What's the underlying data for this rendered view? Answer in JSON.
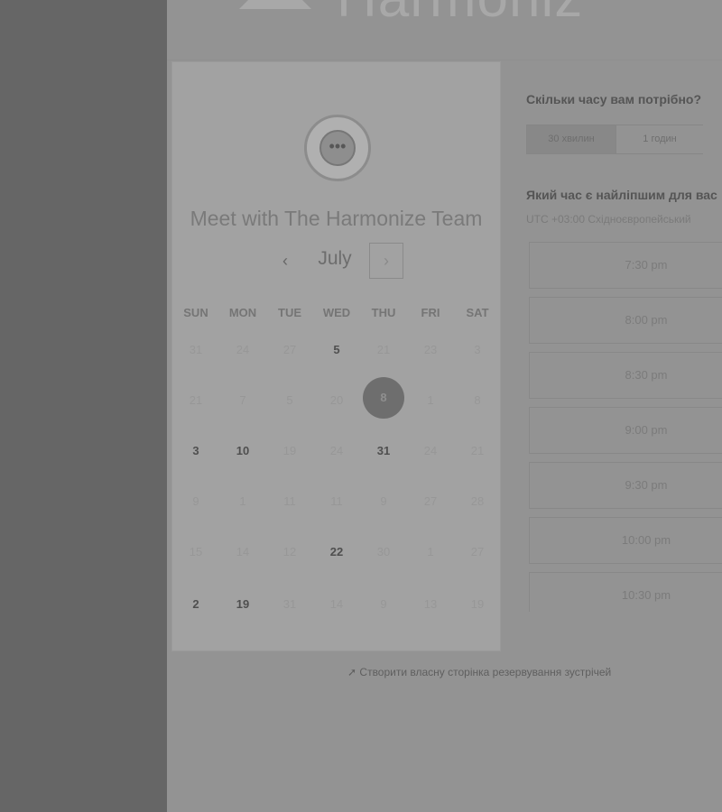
{
  "header": {
    "brand_text": "Harmoniz"
  },
  "card": {
    "title": "Meet with The Harmonize Team",
    "month": "July",
    "prev_icon": "‹",
    "next_icon": "›",
    "weekdays": [
      "SUN",
      "MON",
      "TUE",
      "WED",
      "THU",
      "FRI",
      "SAT"
    ],
    "weeks": [
      [
        "31",
        "24",
        "27",
        "5",
        "21",
        "23",
        "3"
      ],
      [
        "21",
        "7",
        "5",
        "20",
        "8",
        "1",
        "8"
      ],
      [
        "3",
        "10",
        "19",
        "24",
        "31",
        "24",
        "21"
      ],
      [
        "9",
        "1",
        "11",
        "11",
        "9",
        "27",
        "28"
      ],
      [
        "15",
        "14",
        "12",
        "22",
        "30",
        "1",
        "27"
      ],
      [
        "2",
        "19",
        "31",
        "14",
        "9",
        "13",
        "19"
      ]
    ],
    "selected_day": "8"
  },
  "right": {
    "question1": "Скільки часу вам потрібно?",
    "duration_option1": "30 хвилин",
    "duration_option2": "1 годин",
    "question2": "Який час є найліпшим для вас",
    "timezone": "UTC +03:00 Східноєвропейський",
    "slots": [
      "7:30 pm",
      "8:00 pm",
      "8:30 pm",
      "9:00 pm",
      "9:30 pm",
      "10:00 pm",
      "10:30 pm"
    ]
  },
  "footer": {
    "link_text": "Створити власну сторінка резервування зустрічей"
  }
}
